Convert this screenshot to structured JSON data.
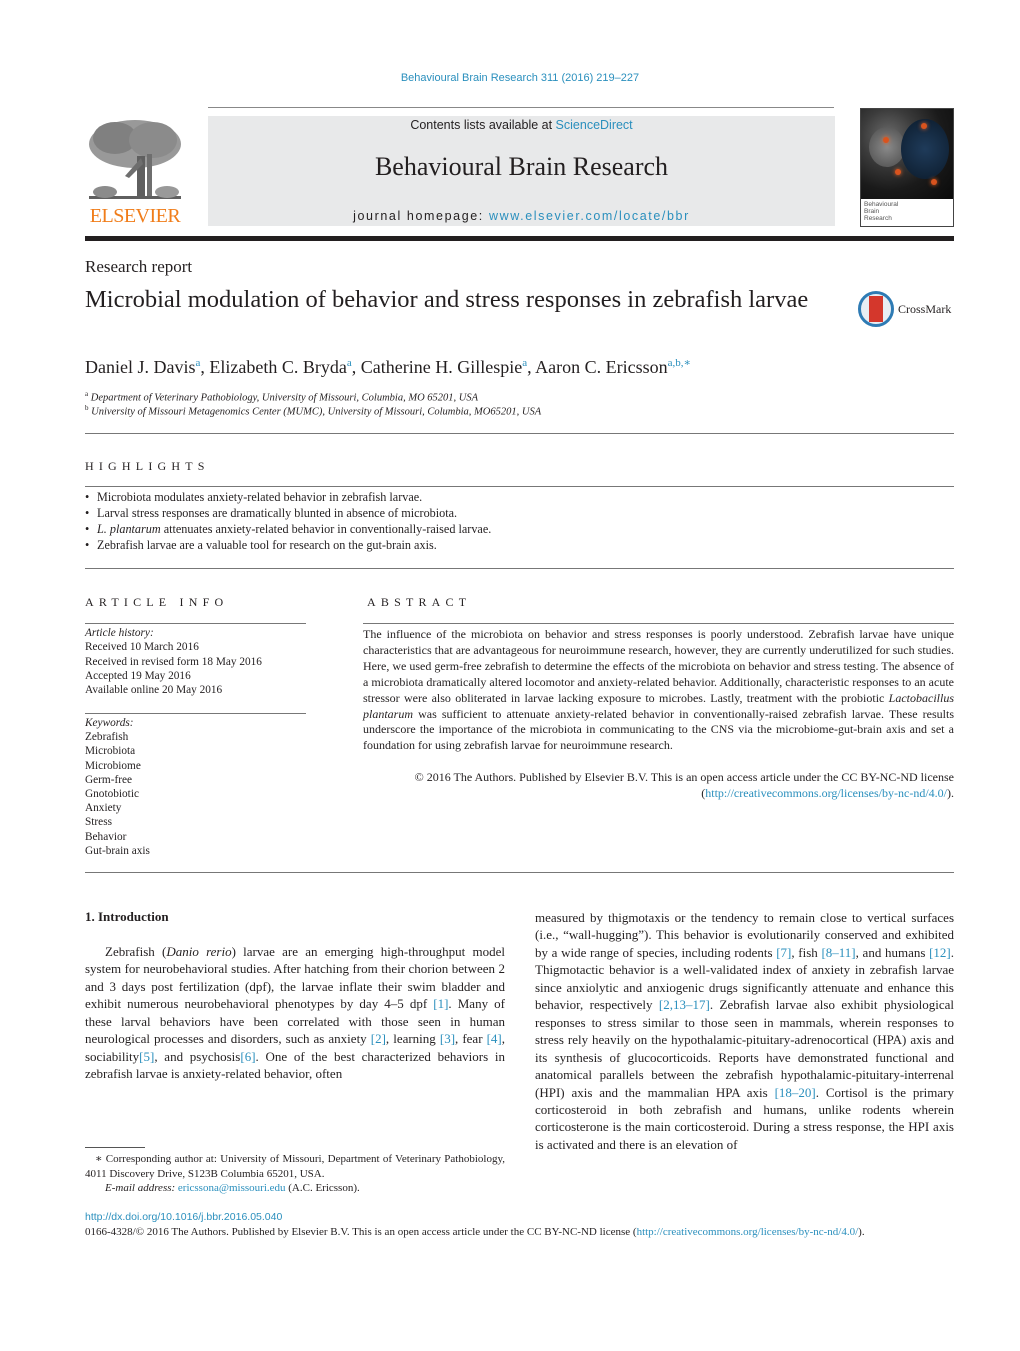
{
  "header": {
    "journal_reference": "Behavioural Brain Research 311 (2016) 219–227",
    "contents_prefix": "Contents lists available at ",
    "contents_link": "ScienceDirect",
    "journal_title": "Behavioural Brain Research",
    "homepage_prefix": "journal homepage: ",
    "homepage_link": "www.elsevier.com/locate/bbr",
    "publisher_logo": "ELSEVIER",
    "cover_text": [
      "Behavioural",
      "Brain",
      "Research"
    ]
  },
  "article": {
    "type": "Research report",
    "title": "Microbial modulation of behavior and stress responses in zebrafish larvae",
    "crossmark_label": "CrossMark",
    "authors": [
      {
        "name": "Daniel J. Davis",
        "sup": "a"
      },
      {
        "name": "Elizabeth C. Bryda",
        "sup": "a"
      },
      {
        "name": "Catherine H. Gillespie",
        "sup": "a"
      },
      {
        "name": "Aaron C. Ericsson",
        "sup": "a,b,∗"
      }
    ],
    "affiliations": [
      {
        "key": "a",
        "text": "Department of Veterinary Pathobiology, University of Missouri, Columbia, MO 65201, USA"
      },
      {
        "key": "b",
        "text": "University of Missouri Metagenomics Center (MUMC), University of Missouri, Columbia, MO65201, USA"
      }
    ]
  },
  "highlights": {
    "heading": "HIGHLIGHTS",
    "items": [
      {
        "italic": "",
        "text": "Microbiota modulates anxiety-related behavior in zebrafish larvae."
      },
      {
        "italic": "",
        "text": "Larval stress responses are dramatically blunted in absence of microbiota."
      },
      {
        "italic": "L. plantarum",
        "text": " attenuates anxiety-related behavior in conventionally-raised larvae."
      },
      {
        "italic": "",
        "text": "Zebrafish larvae are a valuable tool for research on the gut-brain axis."
      }
    ]
  },
  "article_info": {
    "heading": "ARTICLE INFO",
    "history_label": "Article history:",
    "history": [
      "Received 10 March 2016",
      "Received in revised form 18 May 2016",
      "Accepted 19 May 2016",
      "Available online 20 May 2016"
    ],
    "keywords_label": "Keywords:",
    "keywords": [
      "Zebrafish",
      "Microbiota",
      "Microbiome",
      "Germ-free",
      "Gnotobiotic",
      "Anxiety",
      "Stress",
      "Behavior",
      "Gut-brain axis"
    ]
  },
  "abstract": {
    "heading": "ABSTRACT",
    "text_1": "The influence of the microbiota on behavior and stress responses is poorly understood. Zebrafish larvae have unique characteristics that are advantageous for neuroimmune research, however, they are currently underutilized for such studies. Here, we used germ-free zebrafish to determine the effects of the microbiota on behavior and stress testing. The absence of a microbiota dramatically altered locomotor and anxiety-related behavior. Additionally, characteristic responses to an acute stressor were also obliterated in larvae lacking exposure to microbes. Lastly, treatment with the probiotic ",
    "italic": "Lactobacillus plantarum",
    "text_2": " was sufficient to attenuate anxiety-related behavior in conventionally-raised zebrafish larvae. These results underscore the importance of the microbiota in communicating to the CNS via the microbiome-gut-brain axis and set a foundation for using zebrafish larvae for neuroimmune research.",
    "copyright": "© 2016 The Authors. Published by Elsevier B.V. This is an open access article under the CC BY-NC-ND license (",
    "license_link": "http://creativecommons.org/licenses/by-nc-nd/4.0/",
    "copyright_end": ")."
  },
  "introduction": {
    "heading": "1.  Introduction",
    "left": [
      {
        "t": "Zebrafish ("
      },
      {
        "i": "Danio rerio"
      },
      {
        "t": ") larvae are an emerging high-throughput model system for neurobehavioral studies. After hatching from their chorion between 2 and 3 days post fertilization (dpf), the larvae inflate their swim bladder and exhibit numerous neurobehavioral phenotypes by day 4–5 dpf "
      },
      {
        "c": "[1]"
      },
      {
        "t": ". Many of these larval behaviors have been correlated with those seen in human neurological processes and disorders, such as anxiety "
      },
      {
        "c": "[2]"
      },
      {
        "t": ", learning "
      },
      {
        "c": "[3]"
      },
      {
        "t": ", fear "
      },
      {
        "c": "[4]"
      },
      {
        "t": ", sociability"
      },
      {
        "c": "[5]"
      },
      {
        "t": ", and psychosis"
      },
      {
        "c": "[6]"
      },
      {
        "t": ". One of the best characterized behaviors in zebrafish larvae is anxiety-related behavior, often"
      }
    ],
    "right": [
      {
        "t": "measured by thigmotaxis or the tendency to remain close to vertical surfaces (i.e., “wall-hugging”). This behavior is evolutionarily conserved and exhibited by a wide range of species, including rodents "
      },
      {
        "c": "[7]"
      },
      {
        "t": ", fish "
      },
      {
        "c": "[8–11]"
      },
      {
        "t": ", and humans "
      },
      {
        "c": "[12]"
      },
      {
        "t": ". Thigmotactic behavior is a well-validated index of anxiety in zebrafish larvae since anxiolytic and anxiogenic drugs significantly attenuate and enhance this behavior, respectively "
      },
      {
        "c": "[2,13–17]"
      },
      {
        "t": ". Zebrafish larvae also exhibit physiological responses to stress similar to those seen in mammals, wherein responses to stress rely heavily on the hypothalamic-pituitary-adrenocortical (HPA) axis and its synthesis of glucocorticoids. Reports have demonstrated functional and anatomical parallels between the zebrafish hypothalamic-pituitary-interrenal (HPI) axis and the mammalian HPA axis "
      },
      {
        "c": "[18–20]"
      },
      {
        "t": ". Cortisol is the primary corticosteroid in both zebrafish and humans, unlike rodents wherein corticosterone is the main corticosteroid. During a stress response, the HPI axis is activated and there is an elevation of"
      }
    ]
  },
  "footnotes": {
    "corresponding": "∗  Corresponding author at: University of Missouri, Department of Veterinary Pathobiology, 4011 Discovery Drive, S123B Columbia 65201, USA.",
    "email_label": "E-mail address: ",
    "email": "ericssona@missouri.edu",
    "email_suffix": " (A.C. Ericsson)."
  },
  "footer": {
    "doi": "http://dx.doi.org/10.1016/j.bbr.2016.05.040",
    "issn_text": "0166-4328/© 2016 The Authors. Published by Elsevier B.V. This is an open access article under the CC BY-NC-ND license (",
    "license_link": "http://creativecommons.org/licenses/by-nc-nd/4.0/",
    "issn_end": ")."
  },
  "colors": {
    "link": "#2a8fbd",
    "elsevier_orange": "#f07d1a",
    "banner_bg": "#e8e9ea",
    "text": "#231f20"
  }
}
